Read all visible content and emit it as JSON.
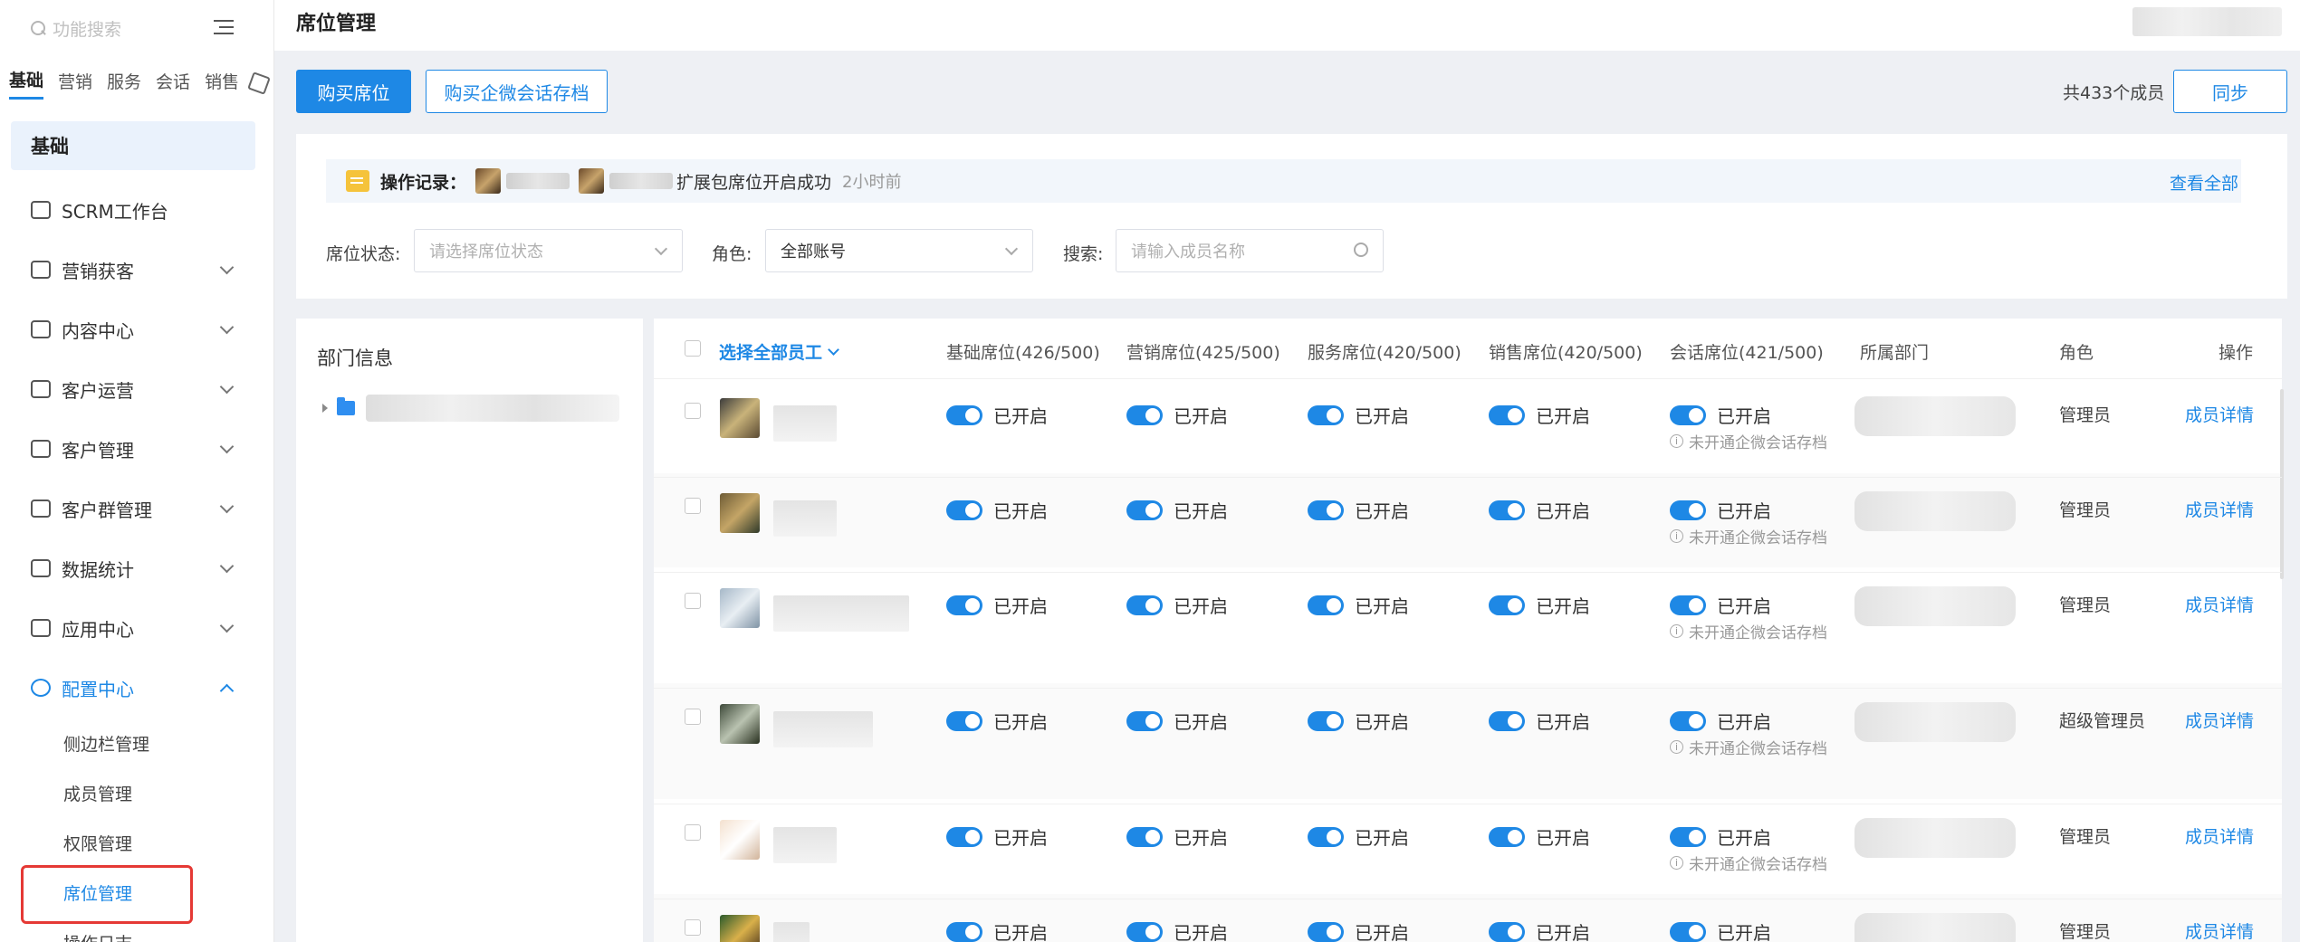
{
  "sidebar": {
    "search_placeholder": "功能搜索",
    "tabs": [
      "基础",
      "营销",
      "服务",
      "会话",
      "销售"
    ],
    "group_label": "基础",
    "items": [
      "SCRM工作台",
      "营销获客",
      "内容中心",
      "客户运营",
      "客户管理",
      "客户群管理",
      "数据统计",
      "应用中心",
      "配置中心"
    ],
    "sub_items": [
      "侧边栏管理",
      "成员管理",
      "权限管理",
      "席位管理",
      "操作日志"
    ]
  },
  "header": {
    "title": "席位管理"
  },
  "toolbar": {
    "buy_seat": "购买席位",
    "buy_archive": "购买企微会话存档",
    "member_count": "共433个成员",
    "sync": "同步"
  },
  "oplog": {
    "label": "操作记录：",
    "text": "扩展包席位开启成功",
    "time": "2小时前",
    "view_all": "查看全部"
  },
  "filters": {
    "status_label": "席位状态:",
    "status_placeholder": "请选择席位状态",
    "role_label": "角色:",
    "role_value": "全部账号",
    "search_label": "搜索:",
    "search_placeholder": "请输入成员名称"
  },
  "dept": {
    "title": "部门信息"
  },
  "table": {
    "headers": {
      "select_all": "选择全部员工",
      "basic": "基础席位(426/500)",
      "marketing": "营销席位(425/500)",
      "service": "服务席位(420/500)",
      "sales": "销售席位(420/500)",
      "session": "会话席位(421/500)",
      "department": "所属部门",
      "role": "角色",
      "action": "操作"
    },
    "toggle_text": "已开启",
    "session_hint": "未开通企微会话存档",
    "detail_text": "成员详情",
    "rows": [
      {
        "role": "管理员"
      },
      {
        "role": "管理员"
      },
      {
        "role": "管理员"
      },
      {
        "role": "超级管理员"
      },
      {
        "role": "管理员"
      },
      {
        "role": "管理员"
      }
    ]
  },
  "colors": {
    "accent": "#1e88e5",
    "highlight": "#e53935"
  }
}
